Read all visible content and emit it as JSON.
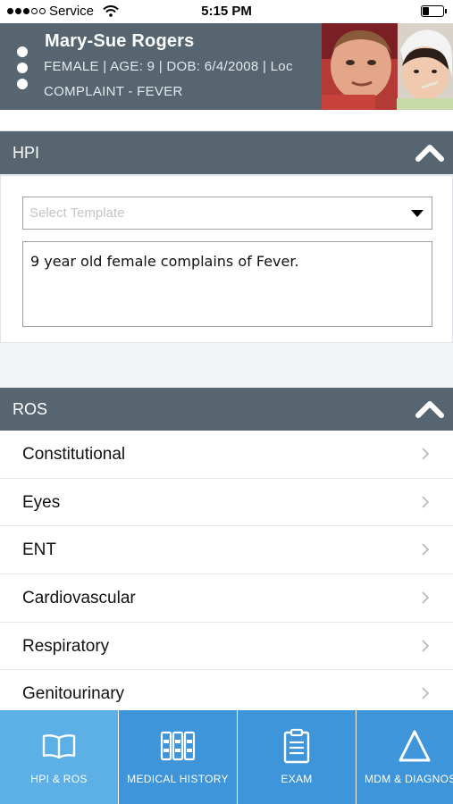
{
  "status_bar": {
    "carrier": "Service",
    "time": "5:15 PM",
    "battery_level": 0.35
  },
  "patient": {
    "name": "Mary-Sue Rogers",
    "info": "FEMALE | AGE: 9 | DOB: 6/4/2008 | Loc",
    "complaint": "COMPLAINT - FEVER"
  },
  "hpi": {
    "title": "HPI",
    "template_placeholder": "Select Template",
    "text": "9 year old female complains of Fever."
  },
  "ros": {
    "title": "ROS",
    "items": [
      {
        "label": "Constitutional"
      },
      {
        "label": "Eyes"
      },
      {
        "label": "ENT"
      },
      {
        "label": "Cardiovascular"
      },
      {
        "label": "Respiratory"
      },
      {
        "label": "Genitourinary"
      }
    ]
  },
  "tabs": [
    {
      "label": "HPI & ROS",
      "icon": "book-icon",
      "active": true
    },
    {
      "label": "MEDICAL HISTORY",
      "icon": "binders-icon",
      "active": false
    },
    {
      "label": "EXAM",
      "icon": "clipboard-icon",
      "active": false
    },
    {
      "label": "MDM & DIAGNOS",
      "icon": "delta-icon",
      "active": false
    }
  ],
  "colors": {
    "header_bg": "#566570",
    "tab_bg": "#3f95d9",
    "tab_active_bg": "#5cb0e6"
  }
}
